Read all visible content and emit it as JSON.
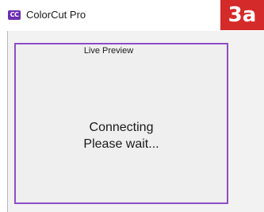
{
  "window": {
    "app_logo_text": "CC",
    "title": "ColorCut Pro",
    "step_badge": "3a"
  },
  "preview": {
    "label": "Live Preview",
    "status_line1": "Connecting",
    "status_line2": "Please wait..."
  },
  "colors": {
    "logo": "#6b2fb3",
    "badge": "#d42a2a",
    "panel_border": "#8e4ec6"
  }
}
